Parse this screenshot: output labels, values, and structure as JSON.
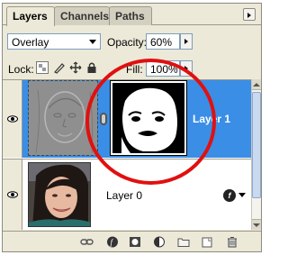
{
  "tabs": [
    {
      "label": "Layers",
      "active": true
    },
    {
      "label": "Channels",
      "active": false
    },
    {
      "label": "Paths",
      "active": false
    }
  ],
  "blend_mode": {
    "value": "Overlay"
  },
  "opacity": {
    "label": "Opacity:",
    "value": "60%"
  },
  "lock": {
    "label": "Lock:",
    "icons": [
      "lock-transparent-icon",
      "brush-icon",
      "move-icon",
      "padlock-icon"
    ]
  },
  "fill": {
    "label": "Fill:",
    "value": "100%"
  },
  "layers": [
    {
      "name": "Layer 1",
      "selected": true,
      "visible": true,
      "has_mask": true
    },
    {
      "name": "Layer 0",
      "selected": false,
      "visible": true,
      "has_effects": true
    }
  ],
  "colors": {
    "panel_bg": "#ece9d8",
    "selected_row": "#3a8ee6",
    "annotation": "#e01010"
  },
  "bottom_icons": [
    "link-icon",
    "fx-icon",
    "layer-mask-icon",
    "adjustment-icon",
    "folder-icon",
    "new-layer-icon",
    "trash-icon"
  ]
}
